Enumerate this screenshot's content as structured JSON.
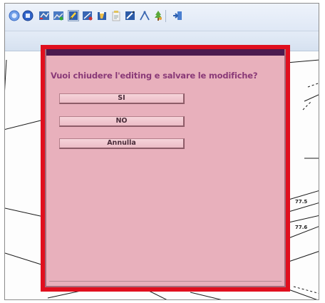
{
  "toolbar": {
    "icons": [
      "back-icon",
      "record-icon",
      "map-grid-icon",
      "layers-icon",
      "edit-polygon-icon",
      "edit-vertex-icon",
      "erase-icon",
      "paste-icon",
      "edit-line-icon",
      "draw-arc-icon",
      "tree-icon",
      "exit-icon"
    ]
  },
  "dialog": {
    "question": "Vuoi chiudere l'editing e salvare le modifiche?",
    "buttons": {
      "yes": "SI",
      "no": "NO",
      "cancel": "Annulla"
    }
  },
  "map": {
    "labels": [
      "77.5",
      "77.6"
    ]
  },
  "colors": {
    "highlight_border": "#e00f1e",
    "dialog_background": "#e8b0bc",
    "dialog_titlebar": "#4b1a4f",
    "question_text": "#8a3a78"
  }
}
